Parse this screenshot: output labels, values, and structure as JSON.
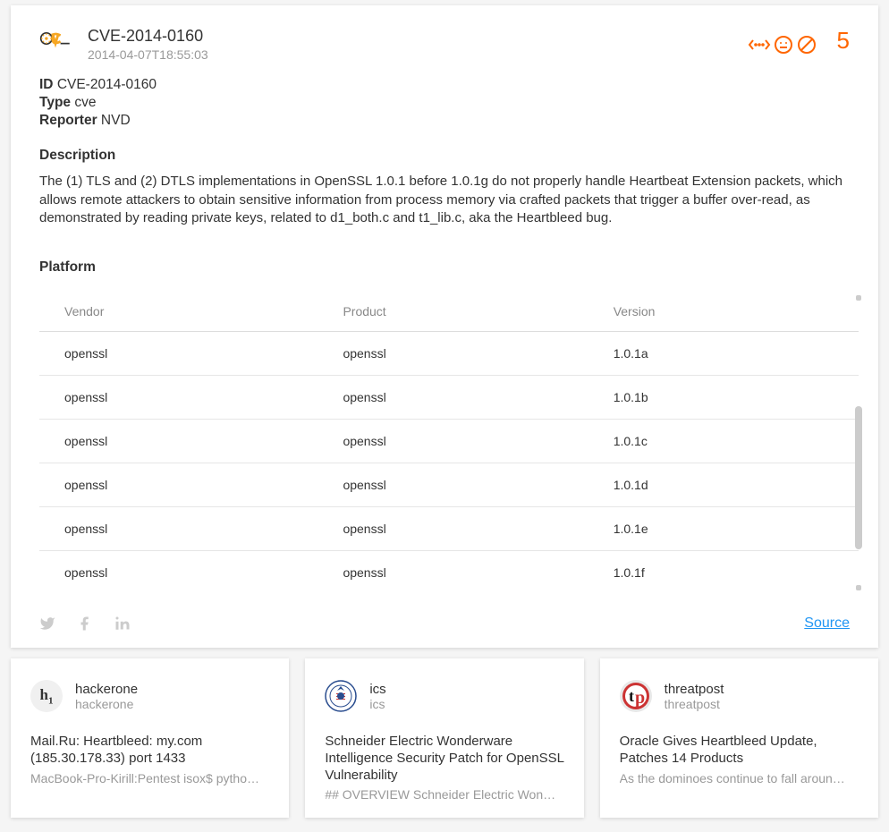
{
  "header": {
    "cve_id": "CVE-2014-0160",
    "timestamp": "2014-04-07T18:55:03",
    "score": "5"
  },
  "meta": {
    "id_label": "ID",
    "id_value": "CVE-2014-0160",
    "type_label": "Type",
    "type_value": "cve",
    "reporter_label": "Reporter",
    "reporter_value": "NVD"
  },
  "section_description_label": "Description",
  "description": "The (1) TLS and (2) DTLS implementations in OpenSSL 1.0.1 before 1.0.1g do not properly handle Heartbeat Extension packets, which allows remote attackers to obtain sensitive information from process memory via crafted packets that trigger a buffer over-read, as demonstrated by reading private keys, related to d1_both.c and t1_lib.c, aka the Heartbleed bug.",
  "section_platform_label": "Platform",
  "table": {
    "headers": [
      "Vendor",
      "Product",
      "Version"
    ],
    "rows": [
      [
        "openssl",
        "openssl",
        "1.0.1a"
      ],
      [
        "openssl",
        "openssl",
        "1.0.1b"
      ],
      [
        "openssl",
        "openssl",
        "1.0.1c"
      ],
      [
        "openssl",
        "openssl",
        "1.0.1d"
      ],
      [
        "openssl",
        "openssl",
        "1.0.1e"
      ],
      [
        "openssl",
        "openssl",
        "1.0.1f"
      ]
    ]
  },
  "footer": {
    "source_label": "Source"
  },
  "related": [
    {
      "source": "hackerone",
      "source_sub": "hackerone",
      "title": "Mail.Ru: Heartbleed: my.com (185.30.178.33) port 1433",
      "excerpt": "MacBook-Pro-Kirill:Pentest isox$ pytho…",
      "icon": "h1"
    },
    {
      "source": "ics",
      "source_sub": "ics",
      "title": "Schneider Electric Wonderware Intelligence Security Patch for OpenSSL Vulnerability",
      "excerpt": "## OVERVIEW Schneider Electric Won…",
      "icon": "seal"
    },
    {
      "source": "threatpost",
      "source_sub": "threatpost",
      "title": "Oracle Gives Heartbleed Update, Patches 14 Products",
      "excerpt": "As the dominoes continue to fall aroun…",
      "icon": "tp"
    }
  ]
}
